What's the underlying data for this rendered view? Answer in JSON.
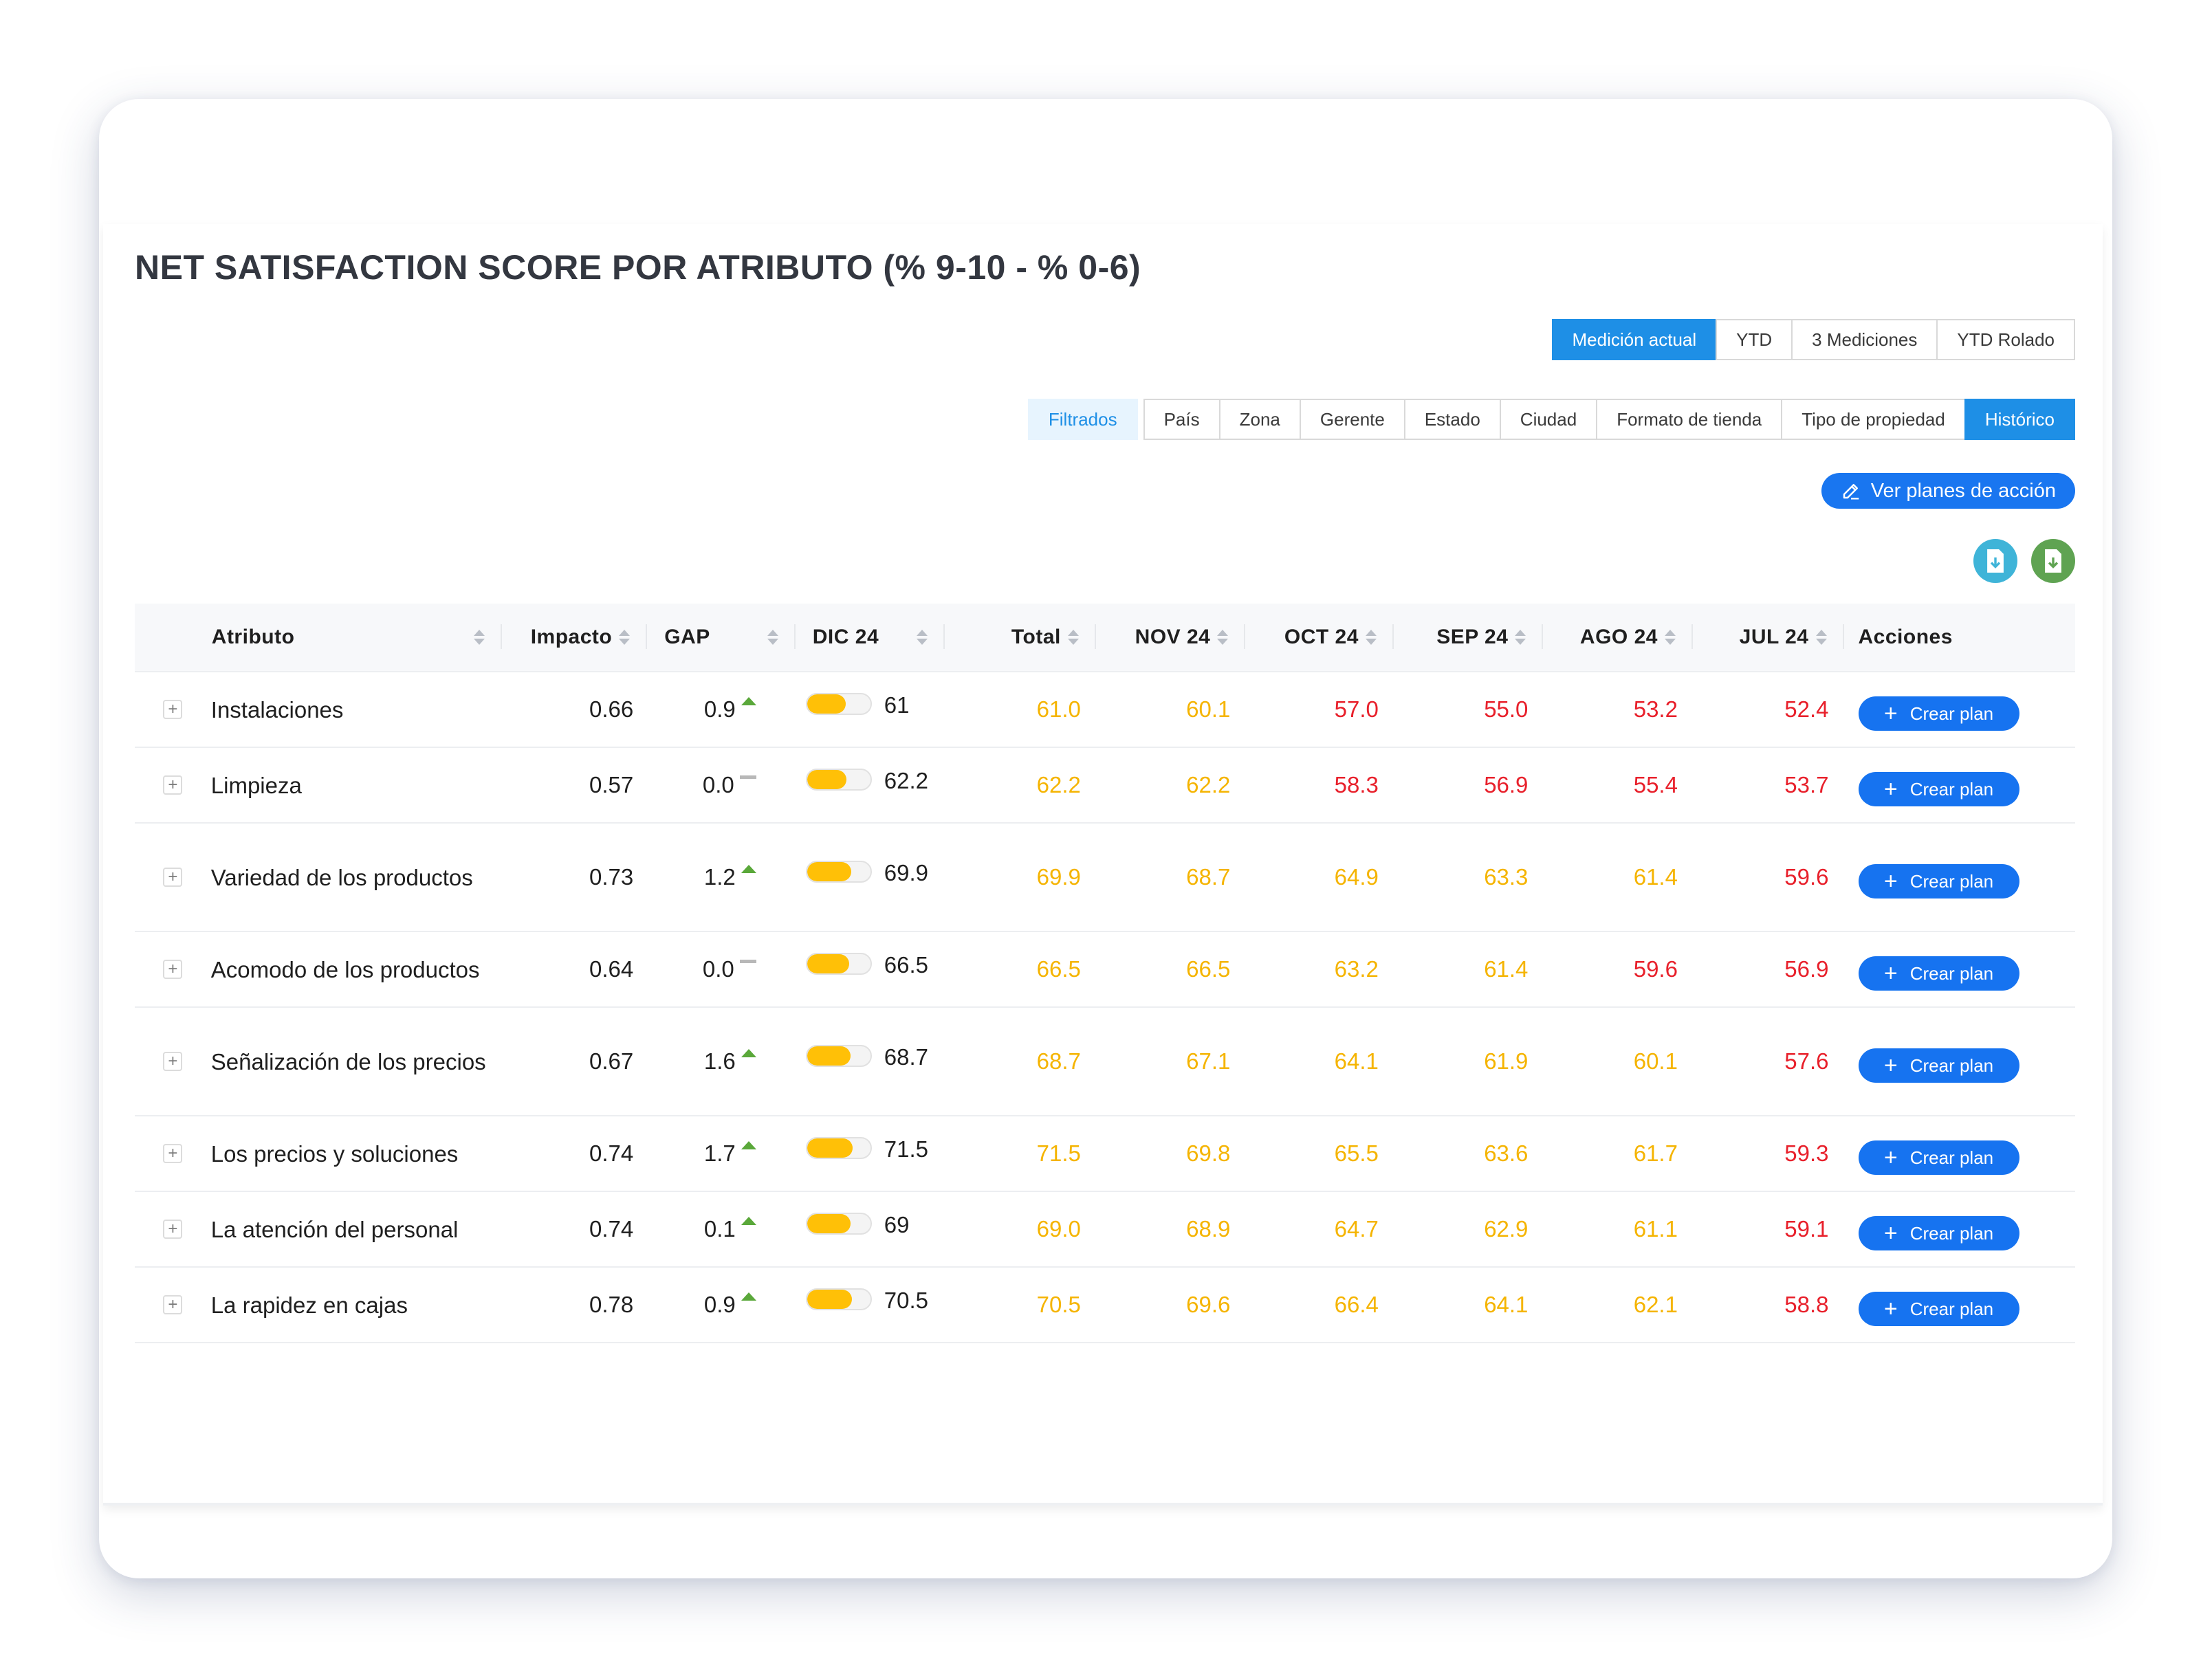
{
  "title": "NET SATISFACTION SCORE POR ATRIBUTO (% 9-10 - % 0-6)",
  "view_modes": [
    {
      "label": "Medición actual",
      "active": true
    },
    {
      "label": "YTD",
      "active": false
    },
    {
      "label": "3 Mediciones",
      "active": false
    },
    {
      "label": "YTD Rolado",
      "active": false
    }
  ],
  "filters": [
    {
      "label": "Filtrados",
      "style": "soft"
    },
    {
      "label": "País",
      "style": "default"
    },
    {
      "label": "Zona",
      "style": "default"
    },
    {
      "label": "Gerente",
      "style": "default"
    },
    {
      "label": "Estado",
      "style": "default"
    },
    {
      "label": "Ciudad",
      "style": "default"
    },
    {
      "label": "Formato de tienda",
      "style": "default"
    },
    {
      "label": "Tipo de propiedad",
      "style": "default"
    },
    {
      "label": "Histórico",
      "style": "active"
    }
  ],
  "action_plans_label": "Ver planes de acción",
  "export_icons": [
    "file-download-icon",
    "excel-download-icon"
  ],
  "colors": {
    "primary": "#1976f0",
    "accent": "#1e8fe6",
    "warn": "#f5b400",
    "bad": "#e8202b",
    "gap_up": "#5aa83a"
  },
  "table": {
    "headers": {
      "atributo": "Atributo",
      "impacto": "Impacto",
      "gap": "GAP",
      "dic": "DIC 24",
      "total": "Total",
      "nov": "NOV 24",
      "oct": "OCT 24",
      "sep": "SEP 24",
      "ago": "AGO 24",
      "jul": "JUL 24",
      "acciones": "Acciones"
    },
    "row_action_label": "Crear plan",
    "rows": [
      {
        "attr": "Instalaciones",
        "impact": "0.66",
        "gap": "0.9",
        "trend": "up",
        "dic": "61",
        "dic_level": 0.61,
        "months": [
          {
            "v": "61.0",
            "c": "warn"
          },
          {
            "v": "60.1",
            "c": "warn"
          },
          {
            "v": "57.0",
            "c": "bad"
          },
          {
            "v": "55.0",
            "c": "bad"
          },
          {
            "v": "53.2",
            "c": "bad"
          },
          {
            "v": "52.4",
            "c": "bad"
          }
        ]
      },
      {
        "attr": "Limpieza",
        "impact": "0.57",
        "gap": "0.0",
        "trend": "flat",
        "dic": "62.2",
        "dic_level": 0.622,
        "months": [
          {
            "v": "62.2",
            "c": "warn"
          },
          {
            "v": "62.2",
            "c": "warn"
          },
          {
            "v": "58.3",
            "c": "bad"
          },
          {
            "v": "56.9",
            "c": "bad"
          },
          {
            "v": "55.4",
            "c": "bad"
          },
          {
            "v": "53.7",
            "c": "bad"
          }
        ]
      },
      {
        "attr": "Variedad de los productos",
        "impact": "0.73",
        "gap": "1.2",
        "trend": "up",
        "dic": "69.9",
        "dic_level": 0.699,
        "months": [
          {
            "v": "69.9",
            "c": "warn"
          },
          {
            "v": "68.7",
            "c": "warn"
          },
          {
            "v": "64.9",
            "c": "warn"
          },
          {
            "v": "63.3",
            "c": "warn"
          },
          {
            "v": "61.4",
            "c": "warn"
          },
          {
            "v": "59.6",
            "c": "bad"
          }
        ]
      },
      {
        "attr": "Acomodo de los productos",
        "impact": "0.64",
        "gap": "0.0",
        "trend": "flat",
        "dic": "66.5",
        "dic_level": 0.665,
        "months": [
          {
            "v": "66.5",
            "c": "warn"
          },
          {
            "v": "66.5",
            "c": "warn"
          },
          {
            "v": "63.2",
            "c": "warn"
          },
          {
            "v": "61.4",
            "c": "warn"
          },
          {
            "v": "59.6",
            "c": "bad"
          },
          {
            "v": "56.9",
            "c": "bad"
          }
        ]
      },
      {
        "attr": "Señalización de los precios",
        "impact": "0.67",
        "gap": "1.6",
        "trend": "up",
        "dic": "68.7",
        "dic_level": 0.687,
        "months": [
          {
            "v": "68.7",
            "c": "warn"
          },
          {
            "v": "67.1",
            "c": "warn"
          },
          {
            "v": "64.1",
            "c": "warn"
          },
          {
            "v": "61.9",
            "c": "warn"
          },
          {
            "v": "60.1",
            "c": "warn"
          },
          {
            "v": "57.6",
            "c": "bad"
          }
        ]
      },
      {
        "attr": "Los precios y soluciones",
        "impact": "0.74",
        "gap": "1.7",
        "trend": "up",
        "dic": "71.5",
        "dic_level": 0.715,
        "months": [
          {
            "v": "71.5",
            "c": "warn"
          },
          {
            "v": "69.8",
            "c": "warn"
          },
          {
            "v": "65.5",
            "c": "warn"
          },
          {
            "v": "63.6",
            "c": "warn"
          },
          {
            "v": "61.7",
            "c": "warn"
          },
          {
            "v": "59.3",
            "c": "bad"
          }
        ]
      },
      {
        "attr": "La atención del personal",
        "impact": "0.74",
        "gap": "0.1",
        "trend": "up",
        "dic": "69",
        "dic_level": 0.69,
        "months": [
          {
            "v": "69.0",
            "c": "warn"
          },
          {
            "v": "68.9",
            "c": "warn"
          },
          {
            "v": "64.7",
            "c": "warn"
          },
          {
            "v": "62.9",
            "c": "warn"
          },
          {
            "v": "61.1",
            "c": "warn"
          },
          {
            "v": "59.1",
            "c": "bad"
          }
        ]
      },
      {
        "attr": "La rapidez en cajas",
        "impact": "0.78",
        "gap": "0.9",
        "trend": "up",
        "dic": "70.5",
        "dic_level": 0.705,
        "months": [
          {
            "v": "70.5",
            "c": "warn"
          },
          {
            "v": "69.6",
            "c": "warn"
          },
          {
            "v": "66.4",
            "c": "warn"
          },
          {
            "v": "64.1",
            "c": "warn"
          },
          {
            "v": "62.1",
            "c": "warn"
          },
          {
            "v": "58.8",
            "c": "bad"
          }
        ]
      }
    ]
  }
}
